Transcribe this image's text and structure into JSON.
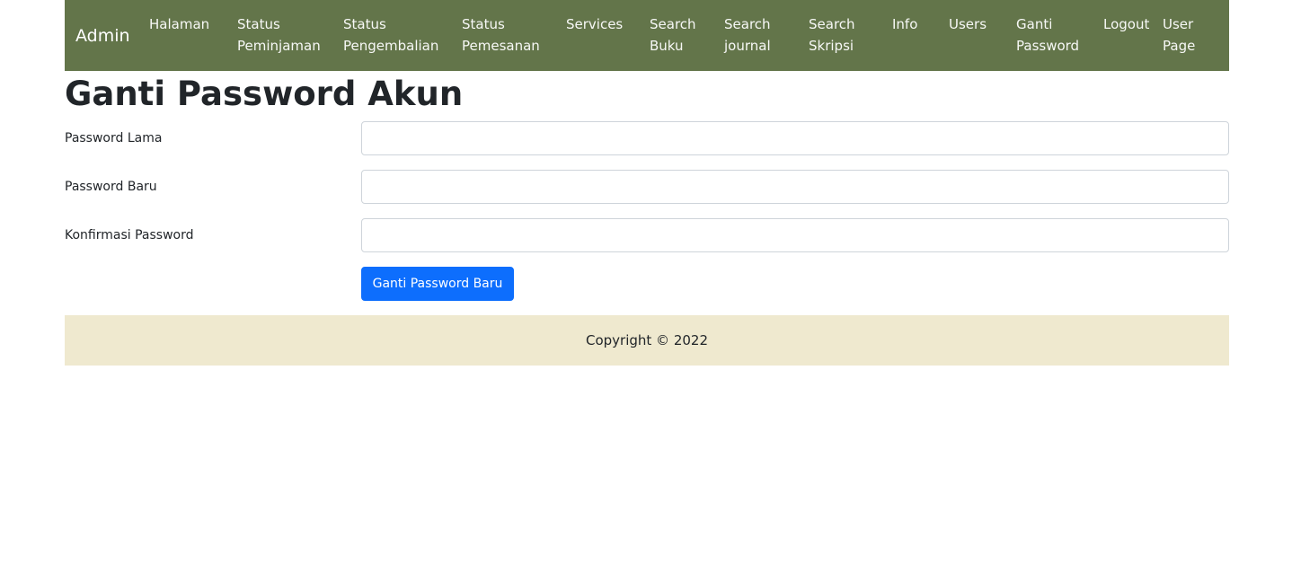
{
  "navbar": {
    "brand": "Admin",
    "items": [
      {
        "line1": "Halaman",
        "line2": ""
      },
      {
        "line1": "Status",
        "line2": "Peminjaman"
      },
      {
        "line1": "Status",
        "line2": "Pengembalian"
      },
      {
        "line1": "Status",
        "line2": "Pemesanan"
      },
      {
        "line1": "Services",
        "line2": ""
      },
      {
        "line1": "Search",
        "line2": "Buku"
      },
      {
        "line1": "Search",
        "line2": "journal"
      },
      {
        "line1": "Search",
        "line2": "Skripsi"
      },
      {
        "line1": "Info",
        "line2": ""
      },
      {
        "line1": "Users",
        "line2": ""
      },
      {
        "line1": "Ganti",
        "line2": "Password"
      },
      {
        "line1": "Logout",
        "line2": ""
      },
      {
        "line1": "User",
        "line2": "Page"
      }
    ],
    "background": "#63754a"
  },
  "page": {
    "title": "Ganti Password Akun"
  },
  "form": {
    "fields": [
      {
        "label": "Password Lama",
        "value": ""
      },
      {
        "label": "Password Baru",
        "value": ""
      },
      {
        "label": "Konfirmasi Password",
        "value": ""
      }
    ],
    "submit_label": "Ganti Password Baru",
    "submit_color": "#0d6efd"
  },
  "footer": {
    "text": "Copyright © 2022",
    "background": "#efe9cf"
  }
}
